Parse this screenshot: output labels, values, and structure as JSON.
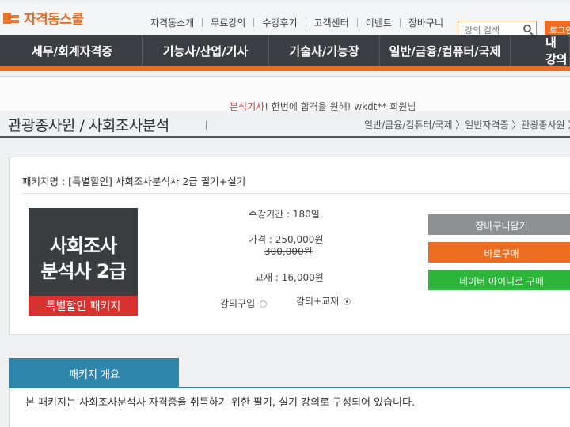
{
  "logo": {
    "text": "자격동스쿨"
  },
  "topnav": {
    "items": [
      "자격동소개",
      "무료강의",
      "수강후기",
      "고객센터",
      "이벤트",
      "장바구니"
    ]
  },
  "search": {
    "placeholder": "강의 검색"
  },
  "login_label": "로그인",
  "mainnav": {
    "tabs": [
      "세무/회계자격증",
      "기능사/산업/기사",
      "기술사/기능장",
      "일반/금융/컴퓨터/국제",
      "내 강의"
    ]
  },
  "banner": {
    "line2_highlight": "분석기사",
    "line2_rest": "! 한번에 합격을 원해! wkdt** 회원님"
  },
  "page_title": "관광종사원 / 사회조사분석",
  "breadcrumb": "일반/금융/컴퓨터/국제 〉일반자격증 〉관광종사원 〉",
  "package": {
    "name": "패키지명 : [특별할인] 사회조사분석사 2급 필기+실기",
    "thumb_line1": "사회조사",
    "thumb_line2": "분석사 2급",
    "thumb_ribbon": "특별할인 패키지",
    "period": "수강기간 : 180일",
    "price": "가격 : 250,000원",
    "original_price": "300,000원",
    "textbook": "교재 : 16,000원",
    "option_lecture": "강의구입",
    "option_lecture_textbook": "강의+교재",
    "selected_option": "강의+교재"
  },
  "buttons": {
    "cart": "장바구니담기",
    "buy": "바로구매",
    "naver": "네이버 아이디로 구매"
  },
  "colors": {
    "brand_orange": "#ec6d21",
    "nav_dark": "#3b3f44",
    "naver_green": "#2db73a",
    "overview_blue": "#2f86ad"
  },
  "overview": {
    "tab_label": "패키지 개요",
    "description": "본 패키지는 사회조사분석사 자격증을 취득하기 위한 필기, 실기 강의로 구성되어 있습니다."
  }
}
